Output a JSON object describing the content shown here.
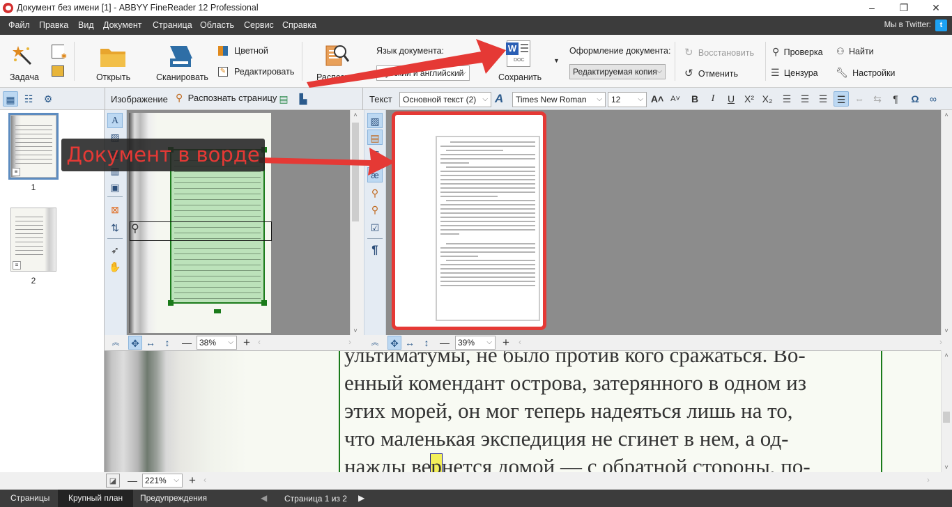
{
  "window": {
    "title": "Документ без имени [1] - ABBYY FineReader 12 Professional",
    "controls": {
      "minimize": "–",
      "maximize": "❐",
      "close": "✕"
    }
  },
  "menu": {
    "items": [
      "Файл",
      "Правка",
      "Вид",
      "Документ",
      "Страница",
      "Область",
      "Сервис",
      "Справка"
    ],
    "twitter_label": "Мы в Twitter:",
    "twitter_icon": "t"
  },
  "ribbon": {
    "task": "Задача",
    "open": "Открыть",
    "scan": "Сканировать",
    "color": "Цветной",
    "edit": "Редактировать",
    "recognize": "Распознать",
    "doc_language_label": "Язык документа:",
    "doc_language_value": "Русский и английский",
    "save": "Сохранить",
    "save_icon_text": "DOC",
    "doc_format_label": "Оформление документа:",
    "doc_format_value": "Редактируемая копия",
    "redo": "Восстановить",
    "undo": "Отменить",
    "verify": "Проверка",
    "redact": "Цензура",
    "find": "Найти",
    "settings": "Настройки"
  },
  "image_panel": {
    "label": "Изображение",
    "recognize_page": "Распознать страницу",
    "zoom": "38%"
  },
  "text_panel": {
    "label": "Текст",
    "style": "Основной текст (2)",
    "font": "Times New Roman",
    "size": "12",
    "zoom": "39%"
  },
  "pages": [
    {
      "number": "1",
      "selected": true
    },
    {
      "number": "2",
      "selected": false
    }
  ],
  "closeup": {
    "lines": [
      "ультиматумы, не было против кого сражаться. Во-",
      "енный комендант острова, затерянного в одном из",
      "этих морей, он мог теперь надеяться лишь на то,",
      "что маленькая экспедиция не сгинет в нем, а од-",
      "нажды ве",
      "р",
      "нется домой — с обратной стороны, по-"
    ],
    "zoom": "221%"
  },
  "statusbar": {
    "tabs": [
      "Страницы",
      "Крупный план",
      "Предупреждения"
    ],
    "active_tab": "Крупный план",
    "page_info": "Страница 1 из 2"
  },
  "annotation": {
    "callout": "Документ в ворде",
    "color": "#e53935"
  },
  "colors": {
    "menubar": "#3c3c3c",
    "accent_blue": "#2b5a8c",
    "selection_green": "#1a7a1a",
    "annotation_red": "#e53935"
  }
}
